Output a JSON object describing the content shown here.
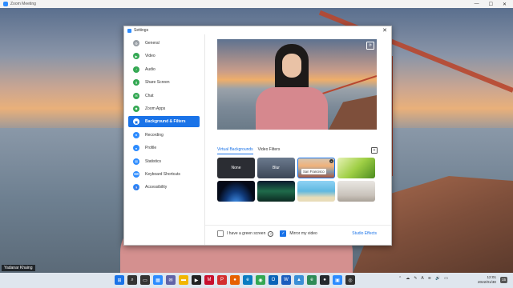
{
  "window": {
    "title": "Zoom Meeting",
    "minimize": "—",
    "maximize": "☐",
    "close": "✕"
  },
  "participant": {
    "name": "Yadanar Khaing"
  },
  "dialog": {
    "title": "Settings",
    "close": "✕",
    "nav": [
      {
        "label": "General",
        "icon": "gear-icon",
        "glyph": "⚙",
        "color": "#9aa0a6"
      },
      {
        "label": "Video",
        "icon": "video-icon",
        "glyph": "▶",
        "color": "#34a853"
      },
      {
        "label": "Audio",
        "icon": "headphones-icon",
        "glyph": "♪",
        "color": "#34a853"
      },
      {
        "label": "Share Screen",
        "icon": "share-screen-icon",
        "glyph": "⬆",
        "color": "#34a853"
      },
      {
        "label": "Chat",
        "icon": "chat-icon",
        "glyph": "✉",
        "color": "#34a853"
      },
      {
        "label": "Zoom Apps",
        "icon": "apps-icon",
        "glyph": "◆",
        "color": "#34a853"
      },
      {
        "label": "Background & Filters",
        "icon": "background-icon",
        "glyph": "▣",
        "color": "#1a73e8"
      },
      {
        "label": "Recording",
        "icon": "recording-icon",
        "glyph": "●",
        "color": "#2d8cff"
      },
      {
        "label": "Profile",
        "icon": "profile-icon",
        "glyph": "●",
        "color": "#2d8cff"
      },
      {
        "label": "Statistics",
        "icon": "statistics-icon",
        "glyph": "▤",
        "color": "#2d8cff"
      },
      {
        "label": "Keyboard Shortcuts",
        "icon": "keyboard-icon",
        "glyph": "⌨",
        "color": "#2d8cff"
      },
      {
        "label": "Accessibility",
        "icon": "accessibility-icon",
        "glyph": "♿",
        "color": "#2d8cff"
      }
    ],
    "active_nav": "Background & Filters",
    "tabs": {
      "virtual": "Virtual Backgrounds",
      "filters": "Video Filters"
    },
    "add_background": "+",
    "rotate_icon": "⟳",
    "tiles": {
      "none": "None",
      "blur": "Blur",
      "sf": "San Francisco",
      "close": "×"
    },
    "footer": {
      "green_screen": "I have a green screen",
      "help": "?",
      "mirror": "Mirror my video",
      "check": "✓",
      "studio": "Studio Effects"
    }
  },
  "taskbar": {
    "apps": [
      {
        "name": "windows-start-icon",
        "glyph": "⊞",
        "color": "#1a73e8"
      },
      {
        "name": "search-icon",
        "glyph": "⌕",
        "color": "#333333"
      },
      {
        "name": "task-view-icon",
        "glyph": "▭",
        "color": "#333333"
      },
      {
        "name": "widgets-icon",
        "glyph": "▦",
        "color": "#2d8cff"
      },
      {
        "name": "chat-teams-icon",
        "glyph": "✉",
        "color": "#6264a7"
      },
      {
        "name": "file-explorer-icon",
        "glyph": "▬",
        "color": "#f2b600"
      },
      {
        "name": "media-icon",
        "glyph": "▶",
        "color": "#222222"
      },
      {
        "name": "mcafee-icon",
        "glyph": "M",
        "color": "#c8102e"
      },
      {
        "name": "pdf-icon",
        "glyph": "P",
        "color": "#d32f2f"
      },
      {
        "name": "firefox-icon",
        "glyph": "●",
        "color": "#e66000"
      },
      {
        "name": "edge-icon",
        "glyph": "e",
        "color": "#0a7cc1"
      },
      {
        "name": "chrome-icon",
        "glyph": "◉",
        "color": "#34a853"
      },
      {
        "name": "outlook-icon",
        "glyph": "O",
        "color": "#0a64b8"
      },
      {
        "name": "word-icon",
        "glyph": "W",
        "color": "#1b5ebe"
      },
      {
        "name": "photos-icon",
        "glyph": "▲",
        "color": "#3a8fd6"
      },
      {
        "name": "edge-dev-icon",
        "glyph": "e",
        "color": "#2e8b57"
      },
      {
        "name": "github-icon",
        "glyph": "●",
        "color": "#24292e"
      },
      {
        "name": "zoom-icon",
        "glyph": "▣",
        "color": "#2d8cff"
      },
      {
        "name": "obs-icon",
        "glyph": "◎",
        "color": "#303030"
      }
    ],
    "tray": {
      "chevron": "⌃",
      "cloud": "☁",
      "pen": "✎",
      "language": "A",
      "wifi": "≋",
      "volume": "🔊",
      "battery": "▭"
    },
    "time": "12:01",
    "date": "2022/01/30",
    "notifications": "15"
  }
}
